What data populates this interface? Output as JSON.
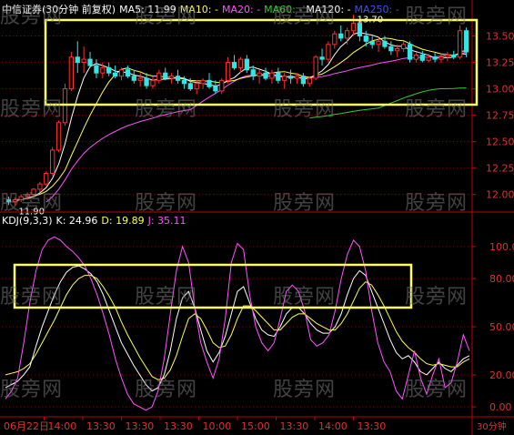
{
  "colors": {
    "background": "#000000",
    "axis": "#c00000",
    "grid": "#7a0000",
    "up": "#ff3030",
    "down": "#33e5e5",
    "ma5": "#ffffff",
    "ma10": "#ffff55",
    "ma20": "#ff55ff",
    "ma60": "#33cc33",
    "ma120": "#ffffff",
    "ma250": "#3355ff",
    "k": "#ffffff",
    "d": "#ffff55",
    "j": "#ff55ff",
    "highlight": "#ffff66"
  },
  "header": {
    "title": "中信证券(30分钟 前复权)",
    "ma5": "MA5: 11.99",
    "ma10": "MA10: -",
    "ma20": "MA20: -",
    "ma60": "MA60: -",
    "ma120": "MA120: -",
    "ma250": "MA250: -"
  },
  "kdj_header": {
    "name": "KDJ(9,3,3)",
    "k": "K: 24.96",
    "d": "D: 19.89",
    "j": "J: 35.11"
  },
  "watermark": "股旁网",
  "chart_data": [
    {
      "type": "candlestick",
      "title": "中信证券(30分钟 前复权)",
      "ylim": [
        11.86,
        13.72
      ],
      "yticks": [
        12.0,
        12.25,
        12.5,
        12.75,
        13.0,
        13.25,
        13.5
      ],
      "annotations": [
        {
          "text": "13.70",
          "bar": 55,
          "price": 13.7
        },
        {
          "text": "11.90",
          "bar": 1,
          "price": 11.9
        }
      ],
      "candles": [
        [
          11.95,
          11.98,
          11.9,
          11.93
        ],
        [
          11.93,
          11.97,
          11.9,
          11.95
        ],
        [
          11.95,
          12.0,
          11.93,
          11.98
        ],
        [
          11.98,
          12.02,
          11.95,
          12.0
        ],
        [
          12.0,
          12.06,
          11.98,
          12.05
        ],
        [
          12.05,
          12.12,
          12.02,
          12.1
        ],
        [
          12.1,
          12.22,
          12.08,
          12.2
        ],
        [
          12.2,
          12.45,
          12.18,
          12.42
        ],
        [
          12.42,
          12.7,
          12.4,
          12.68
        ],
        [
          12.68,
          13.05,
          12.65,
          13.0
        ],
        [
          13.0,
          13.35,
          12.98,
          13.3
        ],
        [
          13.3,
          13.45,
          13.15,
          13.25
        ],
        [
          13.25,
          13.4,
          13.15,
          13.28
        ],
        [
          13.28,
          13.35,
          13.2,
          13.22
        ],
        [
          13.22,
          13.28,
          13.1,
          13.15
        ],
        [
          13.15,
          13.25,
          13.1,
          13.2
        ],
        [
          13.2,
          13.25,
          13.12,
          13.15
        ],
        [
          13.15,
          13.22,
          13.1,
          13.12
        ],
        [
          13.12,
          13.2,
          13.08,
          13.18
        ],
        [
          13.18,
          13.22,
          13.1,
          13.12
        ],
        [
          13.12,
          13.18,
          13.05,
          13.08
        ],
        [
          13.08,
          13.15,
          13.02,
          13.1
        ],
        [
          13.1,
          13.15,
          13.0,
          13.03
        ],
        [
          13.03,
          13.12,
          13.0,
          13.08
        ],
        [
          13.08,
          13.18,
          13.05,
          13.15
        ],
        [
          13.15,
          13.2,
          13.08,
          13.1
        ],
        [
          13.1,
          13.15,
          13.05,
          13.12
        ],
        [
          13.12,
          13.18,
          13.05,
          13.08
        ],
        [
          13.08,
          13.12,
          13.0,
          13.05
        ],
        [
          13.05,
          13.1,
          12.98,
          13.0
        ],
        [
          13.0,
          13.08,
          12.95,
          13.05
        ],
        [
          13.05,
          13.1,
          13.0,
          13.08
        ],
        [
          13.08,
          13.15,
          13.0,
          13.02
        ],
        [
          13.02,
          13.08,
          12.95,
          12.98
        ],
        [
          12.98,
          13.1,
          12.95,
          13.08
        ],
        [
          13.08,
          13.3,
          13.05,
          13.25
        ],
        [
          13.25,
          13.32,
          13.18,
          13.2
        ],
        [
          13.2,
          13.3,
          13.15,
          13.28
        ],
        [
          13.28,
          13.32,
          13.15,
          13.18
        ],
        [
          13.18,
          13.22,
          13.08,
          13.12
        ],
        [
          13.12,
          13.18,
          13.05,
          13.15
        ],
        [
          13.15,
          13.2,
          13.08,
          13.1
        ],
        [
          13.1,
          13.18,
          13.05,
          13.15
        ],
        [
          13.15,
          13.2,
          13.05,
          13.08
        ],
        [
          13.08,
          13.15,
          13.0,
          13.12
        ],
        [
          13.12,
          13.18,
          13.05,
          13.1
        ],
        [
          13.1,
          13.15,
          13.05,
          13.12
        ],
        [
          13.12,
          13.15,
          13.02,
          13.05
        ],
        [
          13.05,
          13.12,
          13.02,
          13.1
        ],
        [
          13.1,
          13.32,
          13.08,
          13.3
        ],
        [
          13.3,
          13.38,
          13.22,
          13.28
        ],
        [
          13.28,
          13.45,
          13.25,
          13.42
        ],
        [
          13.42,
          13.55,
          13.38,
          13.52
        ],
        [
          13.52,
          13.6,
          13.45,
          13.48
        ],
        [
          13.48,
          13.58,
          13.42,
          13.55
        ],
        [
          13.55,
          13.7,
          13.5,
          13.62
        ],
        [
          13.62,
          13.65,
          13.45,
          13.5
        ],
        [
          13.5,
          13.55,
          13.4,
          13.45
        ],
        [
          13.45,
          13.5,
          13.38,
          13.42
        ],
        [
          13.42,
          13.48,
          13.35,
          13.45
        ],
        [
          13.45,
          13.5,
          13.38,
          13.4
        ],
        [
          13.4,
          13.45,
          13.32,
          13.36
        ],
        [
          13.36,
          13.42,
          13.3,
          13.38
        ],
        [
          13.38,
          13.45,
          13.35,
          13.42
        ],
        [
          13.42,
          13.45,
          13.25,
          13.28
        ],
        [
          13.28,
          13.35,
          13.25,
          13.32
        ],
        [
          13.32,
          13.36,
          13.25,
          13.27
        ],
        [
          13.27,
          13.33,
          13.25,
          13.3
        ],
        [
          13.3,
          13.34,
          13.25,
          13.28
        ],
        [
          13.28,
          13.33,
          13.25,
          13.3
        ],
        [
          13.3,
          13.35,
          13.26,
          13.32
        ],
        [
          13.32,
          13.36,
          13.28,
          13.3
        ],
        [
          13.3,
          13.6,
          13.28,
          13.55
        ],
        [
          13.55,
          13.58,
          13.3,
          13.35
        ]
      ],
      "ma60_start_bar": 48
    },
    {
      "type": "line",
      "title": "KDJ(9,3,3)",
      "ylim": [
        -5,
        113
      ],
      "yticks": [
        0.0,
        20.0,
        50.0,
        80.0,
        100.0
      ],
      "series": [
        {
          "name": "K",
          "values": [
            12,
            14,
            16,
            20,
            25,
            38,
            50,
            60,
            70,
            78,
            84,
            87,
            88,
            86,
            83,
            78,
            70,
            60,
            50,
            40,
            33,
            26,
            20,
            14,
            10,
            12,
            20,
            35,
            55,
            68,
            72,
            62,
            48,
            35,
            28,
            34,
            44,
            58,
            72,
            75,
            65,
            55,
            48,
            45,
            44,
            50,
            58,
            62,
            62,
            58,
            52,
            48,
            46,
            46,
            50,
            58,
            70,
            80,
            85,
            82,
            72,
            62,
            52,
            42,
            34,
            30,
            32,
            28,
            22,
            20,
            24,
            28,
            24,
            22,
            26,
            30,
            32
          ]
        },
        {
          "name": "D",
          "values": [
            20,
            21,
            22,
            24,
            27,
            33,
            40,
            47,
            54,
            62,
            70,
            76,
            80,
            82,
            82,
            80,
            75,
            69,
            62,
            53,
            45,
            38,
            31,
            25,
            19,
            17,
            18,
            23,
            32,
            44,
            55,
            58,
            55,
            48,
            40,
            37,
            38,
            45,
            55,
            63,
            63,
            60,
            56,
            52,
            48,
            48,
            52,
            56,
            58,
            58,
            55,
            52,
            50,
            48,
            48,
            52,
            58,
            66,
            74,
            78,
            76,
            70,
            63,
            55,
            47,
            41,
            37,
            34,
            30,
            27,
            26,
            27,
            26,
            25,
            25,
            28,
            30
          ]
        },
        {
          "name": "J",
          "values": [
            5,
            10,
            18,
            40,
            65,
            85,
            98,
            104,
            106,
            104,
            100,
            97,
            93,
            88,
            80,
            70,
            58,
            45,
            30,
            18,
            8,
            2,
            0,
            -2,
            0,
            10,
            30,
            58,
            85,
            100,
            90,
            62,
            40,
            28,
            18,
            30,
            55,
            90,
            102,
            98,
            70,
            50,
            40,
            35,
            40,
            55,
            72,
            76,
            72,
            60,
            42,
            38,
            40,
            45,
            60,
            80,
            95,
            104,
            100,
            85,
            60,
            40,
            28,
            22,
            10,
            5,
            20,
            35,
            18,
            8,
            20,
            30,
            12,
            15,
            28,
            45,
            35
          ]
        }
      ]
    }
  ],
  "x_axis": {
    "labels": [
      "06月22日",
      "14:00",
      "13:30",
      "13:30",
      "13:30",
      "10:00",
      "15:00",
      "13:30",
      "14:00",
      "13:30"
    ],
    "period": "30分钟"
  }
}
